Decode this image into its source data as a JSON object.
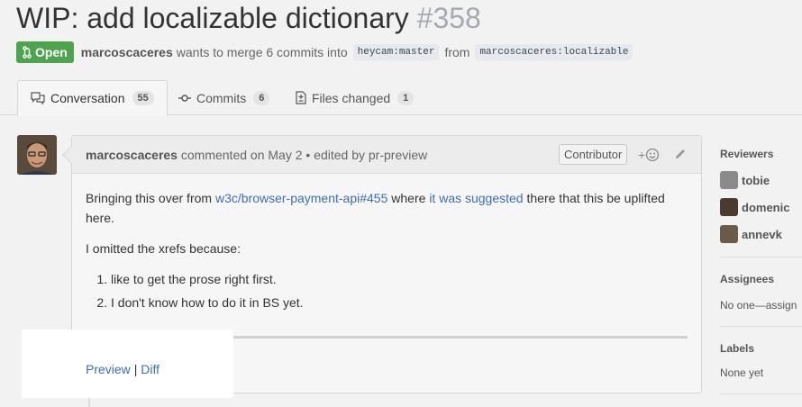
{
  "pr": {
    "title": "WIP: add localizable dictionary",
    "number": "#358",
    "state": "Open",
    "author": "marcoscaceres",
    "merge_text": "wants to merge 6 commits into",
    "base_branch": "heycam:master",
    "from_text": "from",
    "head_branch": "marcoscaceres:localizable"
  },
  "tabs": [
    {
      "label": "Conversation",
      "count": "55"
    },
    {
      "label": "Commits",
      "count": "6"
    },
    {
      "label": "Files changed",
      "count": "1"
    }
  ],
  "comment": {
    "author": "marcoscaceres",
    "meta": "commented on May 2 • edited by pr-preview",
    "badge": "Contributor",
    "react_plus": "+",
    "body_p1_a": "Bringing this over from ",
    "body_link1": "w3c/browser-payment-api#455",
    "body_p1_b": " where ",
    "body_link2": "it was suggested",
    "body_p1_c": " there that this be uplifted here.",
    "body_p2": "I omitted the xrefs because:",
    "list": [
      "like to get the prose right first.",
      "I don't know how to do it in BS yet."
    ],
    "link_preview": "Preview",
    "link_sep": "|",
    "link_diff": "Diff"
  },
  "sidebar": {
    "reviewers_heading": "Reviewers",
    "reviewers": [
      "tobie",
      "domenic",
      "annevk"
    ],
    "assignees_heading": "Assignees",
    "assignees_text": "No one—assign",
    "labels_heading": "Labels",
    "labels_text": "None yet"
  },
  "colors": {
    "open_green": "#4ea44e",
    "link_blue": "#3a6fb5"
  }
}
